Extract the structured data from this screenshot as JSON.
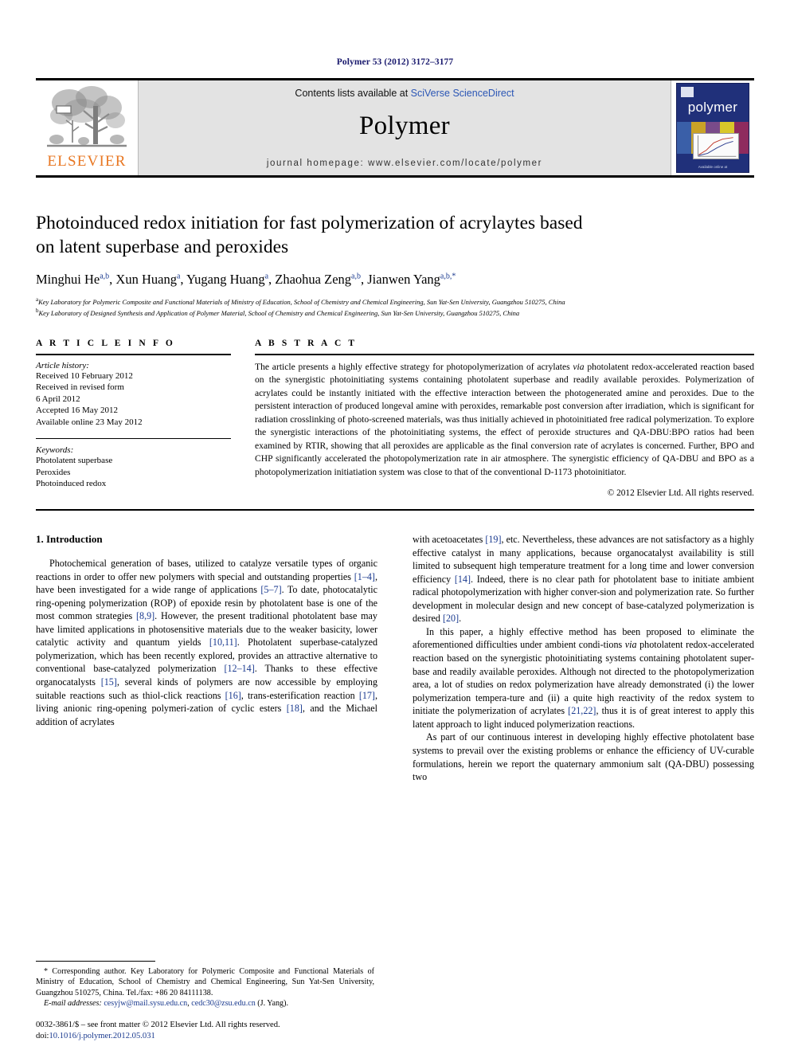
{
  "running_head": "Polymer 53 (2012) 3172–3177",
  "banner": {
    "publisher_logo_label": "ELSEVIER",
    "contents_prefix": "Contents lists available at ",
    "contents_link": "SciVerse ScienceDirect",
    "journal_name": "Polymer",
    "homepage": "journal homepage: www.elsevier.com/locate/polymer",
    "cover_title": "polymer",
    "cover_footer": "Available online at",
    "accent_color": "#E87722",
    "link_color": "#2b56b5",
    "cover_bg": "#20307a"
  },
  "article": {
    "title_line1": "Photoinduced redox initiation for fast polymerization of acrylaytes based",
    "title_line2": "on latent superbase and peroxides",
    "authors": [
      {
        "name": "Minghui He",
        "sup": "a,b"
      },
      {
        "name": "Xun Huang",
        "sup": "a"
      },
      {
        "name": "Yugang Huang",
        "sup": "a"
      },
      {
        "name": "Zhaohua Zeng",
        "sup": "a,b"
      },
      {
        "name": "Jianwen Yang",
        "sup": "a,b,*"
      }
    ],
    "affiliations": [
      {
        "marker": "a",
        "text": "Key Laboratory for Polymeric Composite and Functional Materials of Ministry of Education, School of Chemistry and Chemical Engineering, Sun Yat-Sen University, Guangzhou 510275, China"
      },
      {
        "marker": "b",
        "text": "Key Laboratory of Designed Synthesis and Application of Polymer Material, School of Chemistry and Chemical Engineering, Sun Yat-Sen University, Guangzhou 510275, China"
      }
    ]
  },
  "article_info": {
    "heading": "A R T I C L E  I N F O",
    "history_label": "Article history:",
    "history": [
      "Received 10 February 2012",
      "Received in revised form",
      "6 April 2012",
      "Accepted 16 May 2012",
      "Available online 23 May 2012"
    ],
    "keywords_label": "Keywords:",
    "keywords": [
      "Photolatent superbase",
      "Peroxides",
      "Photoinduced redox"
    ]
  },
  "abstract": {
    "heading": "A B S T R A C T",
    "text_part1": "The article presents a highly effective strategy for photopolymerization of acrylates ",
    "italic1": "via",
    "text_part2": " photolatent redox-accelerated reaction based on the synergistic photoinitiating systems containing photolatent superbase and readily available peroxides. Polymerization of acrylates could be instantly initiated with the effective interaction between the photogenerated amine and peroxides. Due to the persistent interaction of produced longeval amine with peroxides, remarkable post conversion after irradiation, which is significant for radiation crosslinking of photo-screened materials, was thus initially achieved in photoinitiated free radical polymerization. To explore the synergistic interactions of the photoinitiating systems, the effect of peroxide structures and QA-DBU:BPO ratios had been examined by RTIR, showing that all peroxides are applicable as the final conversion rate of acrylates is concerned. Further, BPO and CHP significantly accelerated the photopolymerization rate in air atmosphere. The synergistic efficiency of QA-DBU and BPO as a photopolymerization initiatiation system was close to that of the conventional D-1173 photoinitiator.",
    "copyright": "© 2012 Elsevier Ltd. All rights reserved."
  },
  "introduction": {
    "heading": "1. Introduction",
    "left_p1_a": "Photochemical generation of bases, utilized to catalyze versatile types of organic reactions in order to offer new polymers with special and outstanding properties ",
    "ref1": "[1–4]",
    "left_p1_b": ", have been investigated for a wide range of applications ",
    "ref2": "[5–7]",
    "left_p1_c": ". To date, photocatalytic ring-opening polymerization (ROP) of epoxide resin by photolatent base is one of the most common strategies ",
    "ref3": "[8,9]",
    "left_p1_d": ". However, the present traditional photolatent base may have limited applications in photosensitive materials due to the weaker basicity, lower catalytic activity and quantum yields ",
    "ref4": "[10,11]",
    "left_p1_e": ". Photolatent superbase-catalyzed polymerization, which has been recently explored, provides an attractive alternative to conventional base-catalyzed polymerization ",
    "ref5": "[12–14]",
    "left_p1_f": ". Thanks to these effective organocatalysts ",
    "ref6": "[15]",
    "left_p1_g": ", several kinds of polymers are now accessible by employing suitable reactions such as thiol-click reactions ",
    "ref7": "[16]",
    "left_p1_h": ", trans-esterification reaction ",
    "ref8": "[17]",
    "left_p1_i": ", living anionic ring-opening polymeri-zation of cyclic esters ",
    "ref9": "[18]",
    "left_p1_j": ", and the Michael addition of acrylates",
    "right_p1_a": "with acetoacetates ",
    "ref10": "[19]",
    "right_p1_b": ", etc. Nevertheless, these advances are not satisfactory as a highly effective catalyst in many applications, because organocatalyst availability is still limited to subsequent high temperature treatment for a long time and lower conversion efficiency ",
    "ref11": "[14]",
    "right_p1_c": ". Indeed, there is no clear path for photolatent base to initiate ambient radical photopolymerization with higher conver-sion and polymerization rate. So further development in molecular design and new concept of base-catalyzed polymerization is desired ",
    "ref12": "[20]",
    "right_p1_d": ".",
    "right_p2_a": "In this paper, a highly effective method has been proposed to eliminate the aforementioned difficulties under ambient condi-tions ",
    "italic_via": "via",
    "right_p2_b": " photolatent redox-accelerated reaction based on the synergistic photoinitiating systems containing photolatent super-base and readily available peroxides. Although not directed to the photopolymerization area, a lot of studies on redox polymerization have already demonstrated (i) the lower polymerization tempera-ture and (ii) a quite high reactivity of the redox system to initiate the polymerization of acrylates ",
    "ref13": "[21,22]",
    "right_p2_c": ", thus it is of great interest to apply this latent approach to light induced polymerization reactions.",
    "right_p3": "As part of our continuous interest in developing highly effective photolatent base systems to prevail over the existing problems or enhance the efficiency of UV-curable formulations, herein we report the quaternary ammonium salt (QA-DBU) possessing two"
  },
  "footnotes": {
    "corresponding_marker": "*",
    "corresponding_text": " Corresponding author. Key Laboratory for Polymeric Composite and Functional Materials of Ministry of Education, School of Chemistry and Chemical Engineering, Sun Yat-Sen University, Guangzhou 510275, China. Tel./fax: +86 20 84111138.",
    "email_label": "E-mail addresses:",
    "email1": "cesyjw@mail.sysu.edu.cn",
    "email2": "cedc30@zsu.edu.cn",
    "email_suffix": " (J. Yang).",
    "issn_line": "0032-3861/$ – see front matter © 2012 Elsevier Ltd. All rights reserved.",
    "doi_label": "doi:",
    "doi_value": "10.1016/j.polymer.2012.05.031"
  }
}
